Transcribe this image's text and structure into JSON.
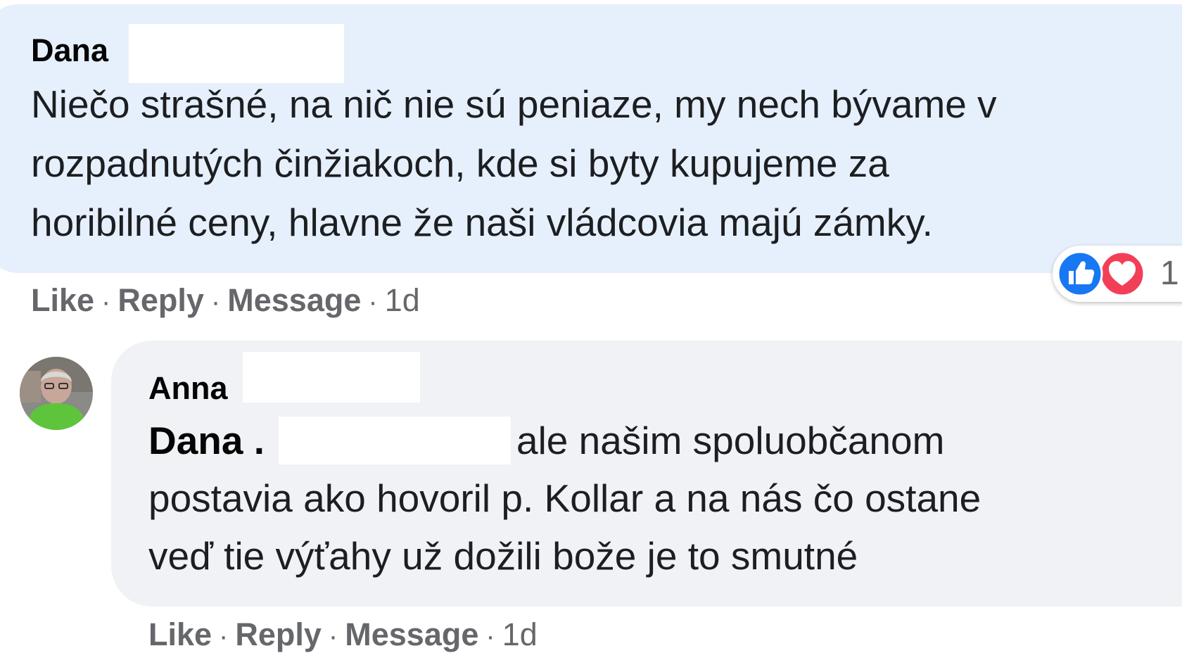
{
  "comments": [
    {
      "author": "Dana",
      "lines": [
        "Niečo strašné, na nič nie sú peniaze, my nech bývame v",
        "rozpadnutých činžiakoch, kde si byty kupujeme za",
        "horibilné ceny, hlavne že naši vládcovia majú zámky."
      ],
      "actions": {
        "like": "Like",
        "reply": "Reply",
        "message": "Message",
        "time": "1d",
        "separator": "·"
      },
      "reactions": {
        "icons": [
          "thumbs-up-icon",
          "heart-icon"
        ],
        "count": "1",
        "like_color": "#1877f2",
        "heart_color": "#f33e58"
      }
    },
    {
      "author": "Anna",
      "mention": "Dana .",
      "lines": [
        "ale našim spoluobčanom",
        "postavia ako hovoril p. Kollar a na nás čo ostane",
        "veď tie výťahy už dožili bože je to smutné"
      ],
      "actions": {
        "like": "Like",
        "reply": "Reply",
        "message": "Message",
        "time": "1d",
        "separator": "·"
      }
    }
  ],
  "colors": {
    "bubble_highlight": "#e6f0fc",
    "bubble_default": "#f0f2f5",
    "meta_text": "#65676b"
  }
}
